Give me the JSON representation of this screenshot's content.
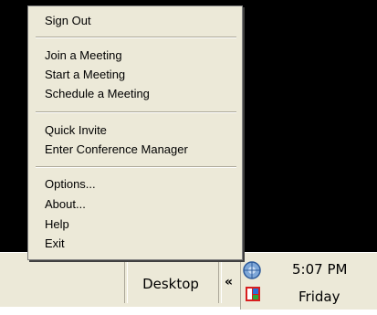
{
  "menu": {
    "items": [
      {
        "label": "Sign Out"
      },
      {
        "label": "Join a Meeting"
      },
      {
        "label": "Start a Meeting"
      },
      {
        "label": "Schedule a Meeting"
      },
      {
        "label": "Quick Invite"
      },
      {
        "label": "Enter Conference Manager"
      },
      {
        "label": "Options..."
      },
      {
        "label": "About..."
      },
      {
        "label": "Help"
      },
      {
        "label": "Exit"
      }
    ]
  },
  "taskbar": {
    "desktop_label": "Desktop",
    "expand_glyph": "»",
    "collapse_glyph": "«"
  },
  "tray": {
    "clock_time": "5:07 PM",
    "clock_day": "Friday",
    "icons": [
      "meeting-app-icon",
      "media-app-icon"
    ]
  }
}
